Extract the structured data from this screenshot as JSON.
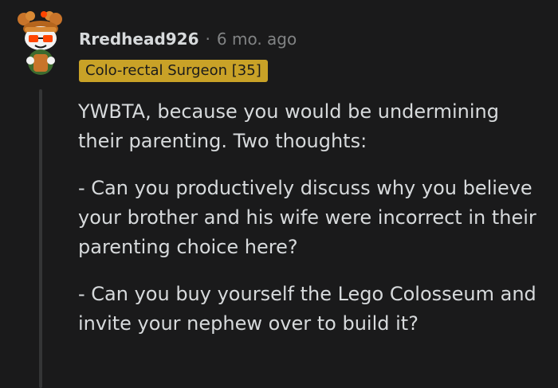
{
  "comment": {
    "username": "Rredhead926",
    "separator": "·",
    "timestamp": "6 mo. ago",
    "flair": "Colo-rectal Surgeon [35]",
    "avatar_icon": "reddit-snoo-avatar-icon",
    "paragraphs": [
      "YWBTA, because you would be undermining their parenting. Two thoughts:",
      "- Can you productively discuss why you believe your brother and his wife were incorrect in their parenting choice here?",
      "- Can you buy yourself the Lego Colosseum and invite your nephew over to build it?"
    ]
  },
  "colors": {
    "background": "#1a1a1b",
    "text": "#d7dadc",
    "muted": "#818384",
    "flair_bg": "#c9a227",
    "thread_line": "#343536"
  }
}
